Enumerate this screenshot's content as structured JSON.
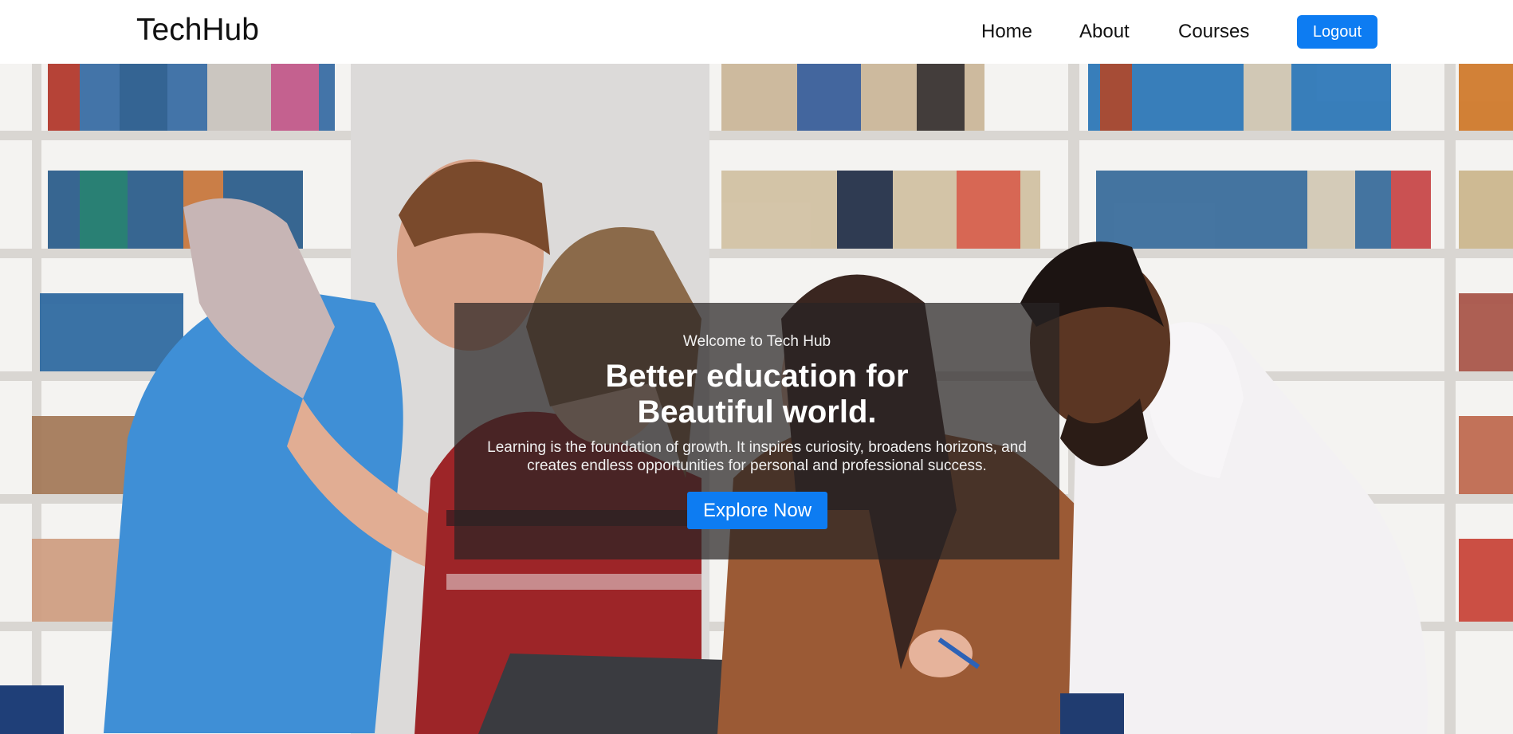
{
  "nav": {
    "brand": "TechHub",
    "links": [
      "Home",
      "About",
      "Courses"
    ],
    "logout_label": "Logout"
  },
  "hero": {
    "image_icon": "students-library-photo",
    "welcome": "Welcome to Tech Hub",
    "headline_line1": "Better education for",
    "headline_line2": "Beautiful world.",
    "description": "Learning is the foundation of growth. It inspires curiosity, broadens horizons, and creates endless opportunities for personal and professional success.",
    "cta_label": "Explore Now"
  },
  "colors": {
    "accent": "#0d7cf2",
    "overlay": "#282424"
  }
}
